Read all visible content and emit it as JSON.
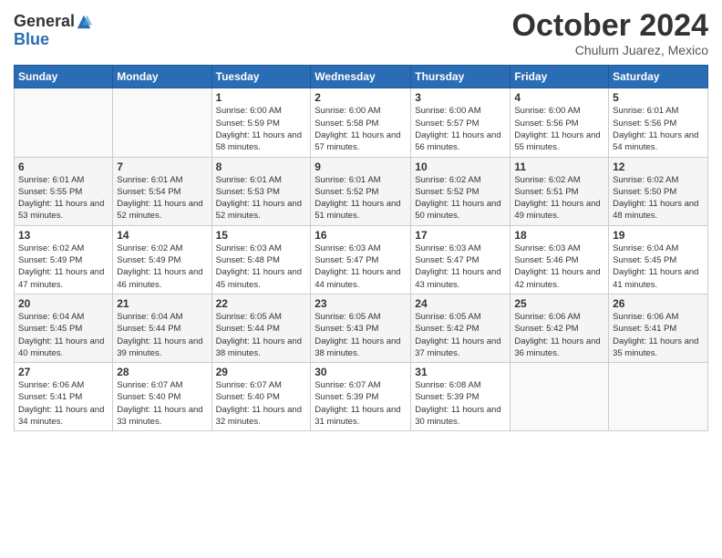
{
  "header": {
    "logo_general": "General",
    "logo_blue": "Blue",
    "month_title": "October 2024",
    "subtitle": "Chulum Juarez, Mexico"
  },
  "days_of_week": [
    "Sunday",
    "Monday",
    "Tuesday",
    "Wednesday",
    "Thursday",
    "Friday",
    "Saturday"
  ],
  "weeks": [
    [
      {
        "day": "",
        "info": ""
      },
      {
        "day": "",
        "info": ""
      },
      {
        "day": "1",
        "info": "Sunrise: 6:00 AM\nSunset: 5:59 PM\nDaylight: 11 hours and 58 minutes."
      },
      {
        "day": "2",
        "info": "Sunrise: 6:00 AM\nSunset: 5:58 PM\nDaylight: 11 hours and 57 minutes."
      },
      {
        "day": "3",
        "info": "Sunrise: 6:00 AM\nSunset: 5:57 PM\nDaylight: 11 hours and 56 minutes."
      },
      {
        "day": "4",
        "info": "Sunrise: 6:00 AM\nSunset: 5:56 PM\nDaylight: 11 hours and 55 minutes."
      },
      {
        "day": "5",
        "info": "Sunrise: 6:01 AM\nSunset: 5:56 PM\nDaylight: 11 hours and 54 minutes."
      }
    ],
    [
      {
        "day": "6",
        "info": "Sunrise: 6:01 AM\nSunset: 5:55 PM\nDaylight: 11 hours and 53 minutes."
      },
      {
        "day": "7",
        "info": "Sunrise: 6:01 AM\nSunset: 5:54 PM\nDaylight: 11 hours and 52 minutes."
      },
      {
        "day": "8",
        "info": "Sunrise: 6:01 AM\nSunset: 5:53 PM\nDaylight: 11 hours and 52 minutes."
      },
      {
        "day": "9",
        "info": "Sunrise: 6:01 AM\nSunset: 5:52 PM\nDaylight: 11 hours and 51 minutes."
      },
      {
        "day": "10",
        "info": "Sunrise: 6:02 AM\nSunset: 5:52 PM\nDaylight: 11 hours and 50 minutes."
      },
      {
        "day": "11",
        "info": "Sunrise: 6:02 AM\nSunset: 5:51 PM\nDaylight: 11 hours and 49 minutes."
      },
      {
        "day": "12",
        "info": "Sunrise: 6:02 AM\nSunset: 5:50 PM\nDaylight: 11 hours and 48 minutes."
      }
    ],
    [
      {
        "day": "13",
        "info": "Sunrise: 6:02 AM\nSunset: 5:49 PM\nDaylight: 11 hours and 47 minutes."
      },
      {
        "day": "14",
        "info": "Sunrise: 6:02 AM\nSunset: 5:49 PM\nDaylight: 11 hours and 46 minutes."
      },
      {
        "day": "15",
        "info": "Sunrise: 6:03 AM\nSunset: 5:48 PM\nDaylight: 11 hours and 45 minutes."
      },
      {
        "day": "16",
        "info": "Sunrise: 6:03 AM\nSunset: 5:47 PM\nDaylight: 11 hours and 44 minutes."
      },
      {
        "day": "17",
        "info": "Sunrise: 6:03 AM\nSunset: 5:47 PM\nDaylight: 11 hours and 43 minutes."
      },
      {
        "day": "18",
        "info": "Sunrise: 6:03 AM\nSunset: 5:46 PM\nDaylight: 11 hours and 42 minutes."
      },
      {
        "day": "19",
        "info": "Sunrise: 6:04 AM\nSunset: 5:45 PM\nDaylight: 11 hours and 41 minutes."
      }
    ],
    [
      {
        "day": "20",
        "info": "Sunrise: 6:04 AM\nSunset: 5:45 PM\nDaylight: 11 hours and 40 minutes."
      },
      {
        "day": "21",
        "info": "Sunrise: 6:04 AM\nSunset: 5:44 PM\nDaylight: 11 hours and 39 minutes."
      },
      {
        "day": "22",
        "info": "Sunrise: 6:05 AM\nSunset: 5:44 PM\nDaylight: 11 hours and 38 minutes."
      },
      {
        "day": "23",
        "info": "Sunrise: 6:05 AM\nSunset: 5:43 PM\nDaylight: 11 hours and 38 minutes."
      },
      {
        "day": "24",
        "info": "Sunrise: 6:05 AM\nSunset: 5:42 PM\nDaylight: 11 hours and 37 minutes."
      },
      {
        "day": "25",
        "info": "Sunrise: 6:06 AM\nSunset: 5:42 PM\nDaylight: 11 hours and 36 minutes."
      },
      {
        "day": "26",
        "info": "Sunrise: 6:06 AM\nSunset: 5:41 PM\nDaylight: 11 hours and 35 minutes."
      }
    ],
    [
      {
        "day": "27",
        "info": "Sunrise: 6:06 AM\nSunset: 5:41 PM\nDaylight: 11 hours and 34 minutes."
      },
      {
        "day": "28",
        "info": "Sunrise: 6:07 AM\nSunset: 5:40 PM\nDaylight: 11 hours and 33 minutes."
      },
      {
        "day": "29",
        "info": "Sunrise: 6:07 AM\nSunset: 5:40 PM\nDaylight: 11 hours and 32 minutes."
      },
      {
        "day": "30",
        "info": "Sunrise: 6:07 AM\nSunset: 5:39 PM\nDaylight: 11 hours and 31 minutes."
      },
      {
        "day": "31",
        "info": "Sunrise: 6:08 AM\nSunset: 5:39 PM\nDaylight: 11 hours and 30 minutes."
      },
      {
        "day": "",
        "info": ""
      },
      {
        "day": "",
        "info": ""
      }
    ]
  ]
}
